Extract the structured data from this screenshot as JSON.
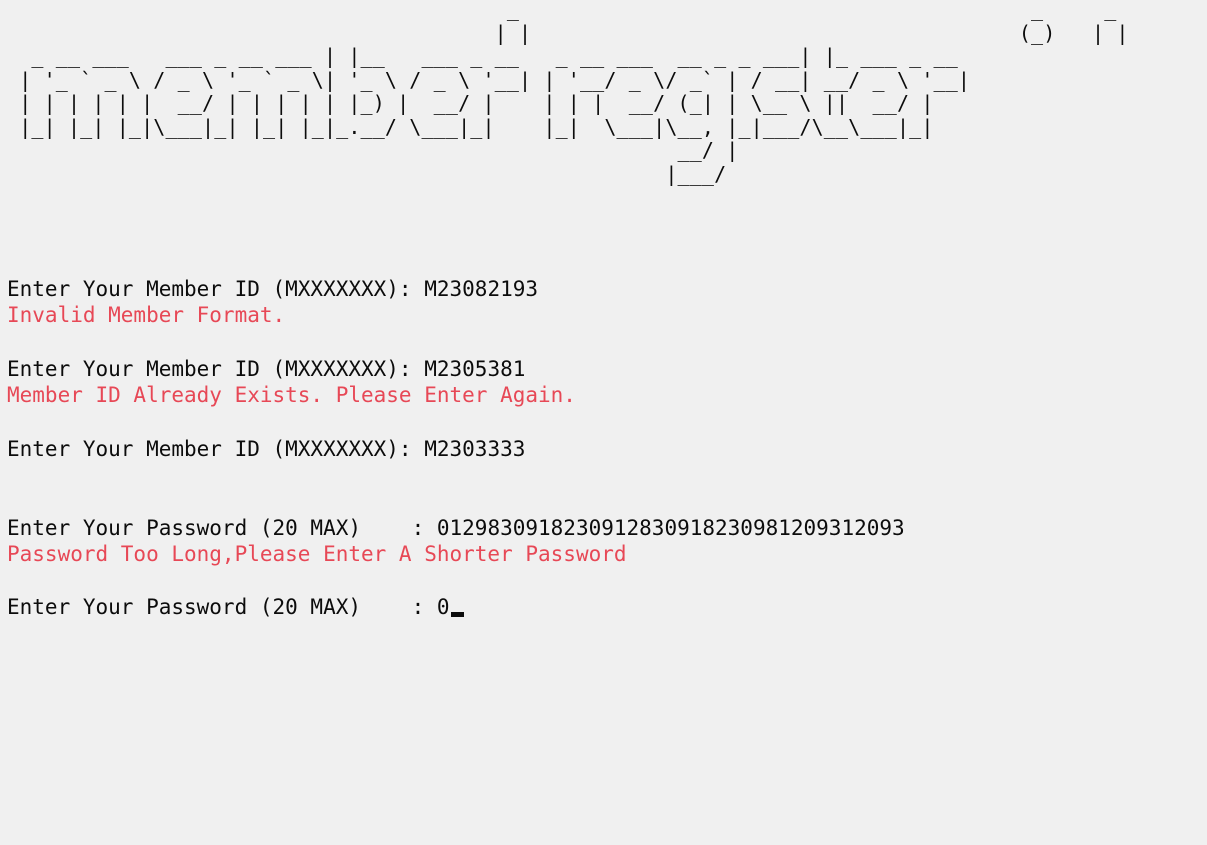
{
  "banner": {
    "art": "                                         _                                          _     _\n                                        | |                                        (_)   | |\n  _ __ ___   ___ _ __ ___ | |__   ___ _ __   _ __ ___  __ _ _ ___| |_ ___ _ __\n | '_ ` _ \\ / _ \\ '_ ` _ \\| '_ \\ / _ \\ '__| | '__/ _ \\/ _` | / __| __/ _ \\ '__|\n | | | | | |  __/ | | | | | |_) |  __/ |    | | |  __/ (_| | \\__ \\ ||  __/ |\n |_| |_| |_|\\___|_| |_| |_|_.__/ \\___|_|    |_|  \\___|\\__, |_|___/\\__\\___|_|\n                                                       __/ |\n                                                      |___/"
  },
  "lines": [
    {
      "prompt": "Enter Your Member ID (MXXXXXXX): ",
      "value": "M23082193"
    },
    {
      "error": "Invalid Member Format."
    },
    {
      "prompt": "Enter Your Member ID (MXXXXXXX): ",
      "value": "M2305381"
    },
    {
      "error": "Member ID Already Exists. Please Enter Again."
    },
    {
      "prompt": "Enter Your Member ID (MXXXXXXX): ",
      "value": "M2303333"
    },
    {
      "prompt": "Enter Your Password (20 MAX)    : ",
      "value": "01298309182309128309182309812093120​93"
    },
    {
      "error": "Password Too Long,Please Enter A Shorter Password"
    },
    {
      "prompt": "Enter Your Password (20 MAX)    : ",
      "value": "0"
    }
  ],
  "colors": {
    "background": "#f0f0f0",
    "text": "#0c0c0c",
    "error": "#e74856"
  }
}
